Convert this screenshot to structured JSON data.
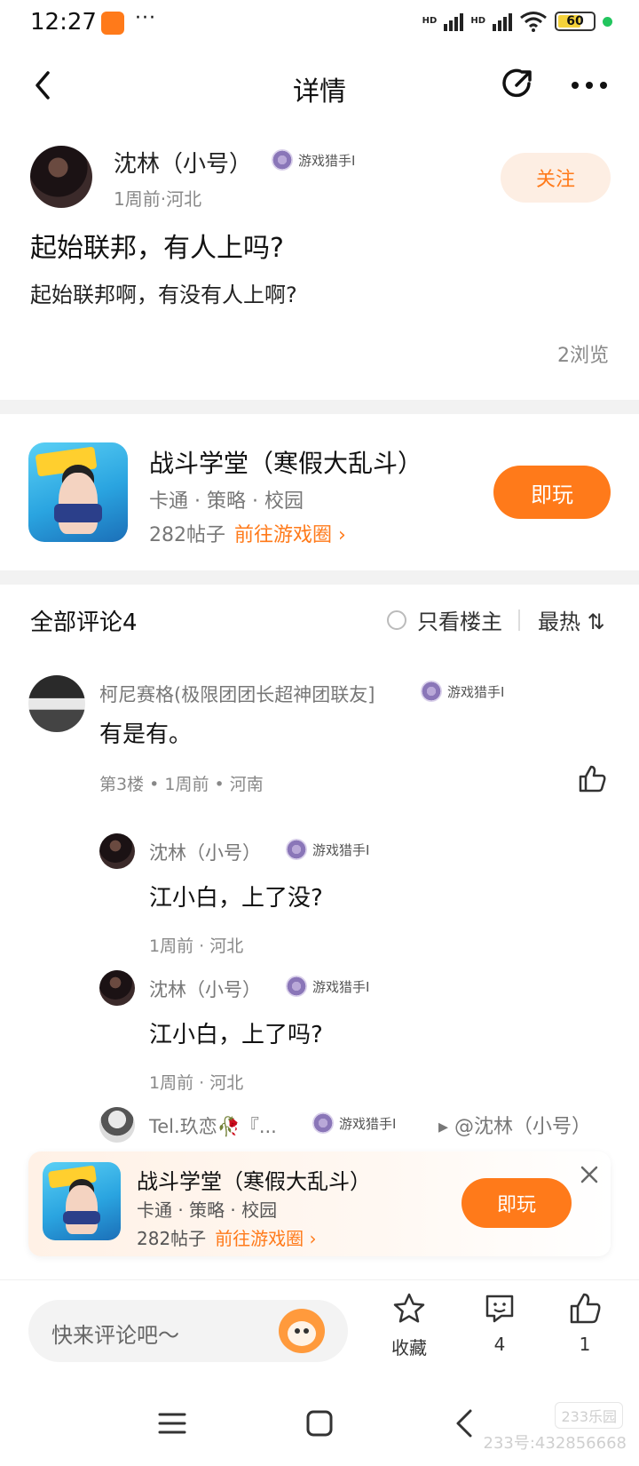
{
  "status_bar": {
    "time": "12:27",
    "dots": "···",
    "hd": "HD",
    "battery": "60"
  },
  "nav": {
    "title": "详情"
  },
  "post": {
    "author": "沈林（小号）",
    "badge": "游戏猎手Ⅰ",
    "meta": "1周前·河北",
    "follow": "关注",
    "title": "起始联邦，有人上吗?",
    "body": "起始联邦啊，有没有人上啊?",
    "views": "2浏览"
  },
  "game": {
    "title": "战斗学堂（寒假大乱斗）",
    "tags": "卡通 · 策略 · 校园",
    "posts": "282帖子",
    "goto": "前往游戏圈",
    "play": "即玩"
  },
  "comments_header": {
    "count": "全部评论4",
    "only_op": "只看楼主",
    "sort": "最热 ⇅"
  },
  "comments": [
    {
      "name": "柯尼赛格(极限团团长超神团联友]",
      "badge": "游戏猎手Ⅰ",
      "text": "有是有。",
      "meta": "第3楼 • 1周前 • 河南"
    }
  ],
  "replies": [
    {
      "name": "沈林（小号）",
      "badge": "游戏猎手Ⅰ",
      "text": "江小白，上了没?",
      "meta": "1周前 · 河北"
    },
    {
      "name": "沈林（小号）",
      "badge": "游戏猎手Ⅰ",
      "text": "江小白，上了吗?",
      "meta": "1周前 · 河北"
    },
    {
      "name": "Tel.玖恋🥀『...",
      "badge": "游戏猎手Ⅰ",
      "reply_to": "▸ @沈林（小号）"
    }
  ],
  "float_card": {
    "title": "战斗学堂（寒假大乱斗）",
    "tags": "卡通 · 策略 · 校园",
    "posts": "282帖子",
    "goto": "前往游戏圈",
    "play": "即玩"
  },
  "bottom_bar": {
    "placeholder": "快来评论吧～",
    "favorite": "收藏",
    "comment_count": "4",
    "like_count": "1"
  },
  "watermark": {
    "logo": "233乐园",
    "id": "233号:432856668"
  },
  "colors": {
    "accent": "#ff7a1a",
    "follow_bg": "#fdeee3",
    "divider": "#f2f2f2"
  },
  "icons": [
    "back-icon",
    "share-icon",
    "more-icon",
    "badge-icon",
    "thumb-up-icon",
    "close-icon",
    "star-icon",
    "comment-icon",
    "menu-icon",
    "home-icon",
    "back-nav-icon"
  ]
}
